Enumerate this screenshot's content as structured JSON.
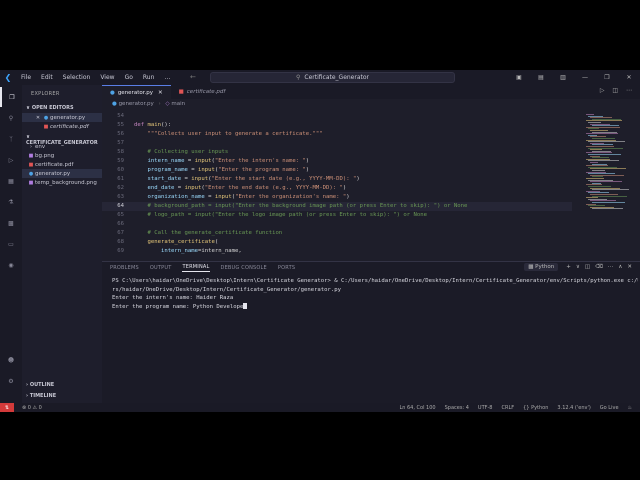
{
  "titlebar": {
    "menus": [
      "File",
      "Edit",
      "Selection",
      "View",
      "Go",
      "Run",
      "…"
    ],
    "search": "Certificate_Generator"
  },
  "sidebar": {
    "title": "EXPLORER",
    "open_editors_label": "OPEN EDITORS",
    "open_editors": [
      {
        "name": "generator.py",
        "type": "py"
      },
      {
        "name": "certificate.pdf",
        "type": "pdf"
      }
    ],
    "folder_label": "CERTIFICATE_GENERATOR",
    "files": [
      {
        "name": "env",
        "type": "folder"
      },
      {
        "name": "bg.png",
        "type": "png"
      },
      {
        "name": "certificate.pdf",
        "type": "pdf"
      },
      {
        "name": "generator.py",
        "type": "py"
      },
      {
        "name": "temp_background.png",
        "type": "png"
      }
    ],
    "outline_label": "OUTLINE",
    "timeline_label": "TIMELINE"
  },
  "editor": {
    "tabs": [
      {
        "name": "generator.py",
        "type": "py"
      },
      {
        "name": "certificate.pdf",
        "type": "pdf"
      }
    ],
    "breadcrumb": [
      "generator.py",
      "main"
    ],
    "current_line": 64,
    "lines": [
      {
        "n": "54",
        "t": ""
      },
      {
        "n": "55",
        "t": "def main():"
      },
      {
        "n": "56",
        "t": "    \"\"\"Collects user input to generate a certificate.\"\"\""
      },
      {
        "n": "57",
        "t": ""
      },
      {
        "n": "58",
        "t": "    # Collecting user inputs"
      },
      {
        "n": "59",
        "t": "    intern_name = input(\"Enter the intern's name: \")"
      },
      {
        "n": "60",
        "t": "    program_name = input(\"Enter the program name: \")"
      },
      {
        "n": "61",
        "t": "    start_date = input(\"Enter the start date (e.g., YYYY-MM-DD): \")"
      },
      {
        "n": "62",
        "t": "    end_date = input(\"Enter the end date (e.g., YYYY-MM-DD): \")"
      },
      {
        "n": "63",
        "t": "    organization_name = input(\"Enter the organization's name: \")"
      },
      {
        "n": "64",
        "t": "    # background_path = input(\"Enter the background image path (or press Enter to skip): \") or None"
      },
      {
        "n": "65",
        "t": "    # logo_path = input(\"Enter the logo image path (or press Enter to skip): \") or None"
      },
      {
        "n": "66",
        "t": ""
      },
      {
        "n": "67",
        "t": "    # Call the generate_certificate function"
      },
      {
        "n": "68",
        "t": "    generate_certificate("
      },
      {
        "n": "69",
        "t": "        intern_name=intern_name,"
      }
    ]
  },
  "panel": {
    "tabs": [
      "PROBLEMS",
      "OUTPUT",
      "TERMINAL",
      "DEBUG CONSOLE",
      "PORTS"
    ],
    "active_tab": "TERMINAL",
    "terminal_name": "Python",
    "terminal": [
      "PS C:\\Users\\haidar\\OneDrive\\Desktop\\Intern\\Certificate Generator> & C:/Users/haidar/OneDrive/Desktop/Intern/Certificate_Generator/env/Scripts/python.exe c:/Use",
      "rs/haidar/OneDrive/Desktop/Intern/Certificate_Generator/generator.py",
      "Enter the intern's name: Haider Raza",
      "Enter the program name: Python Develope"
    ]
  },
  "statusbar": {
    "problems": "⊗ 0  ⚠ 0",
    "position": "Ln 64, Col 100",
    "spaces": "Spaces: 4",
    "encoding": "UTF-8",
    "eol": "CRLF",
    "language": "{} Python",
    "interpreter": "3.12.4 ('env')",
    "golive": "Go Live"
  },
  "colors": {
    "accent": "#5a7ee6",
    "remote": "#d33a3a",
    "keyword": "#c586c0",
    "function": "#e8c97a",
    "string": "#ce9178",
    "comment": "#6a9955"
  }
}
